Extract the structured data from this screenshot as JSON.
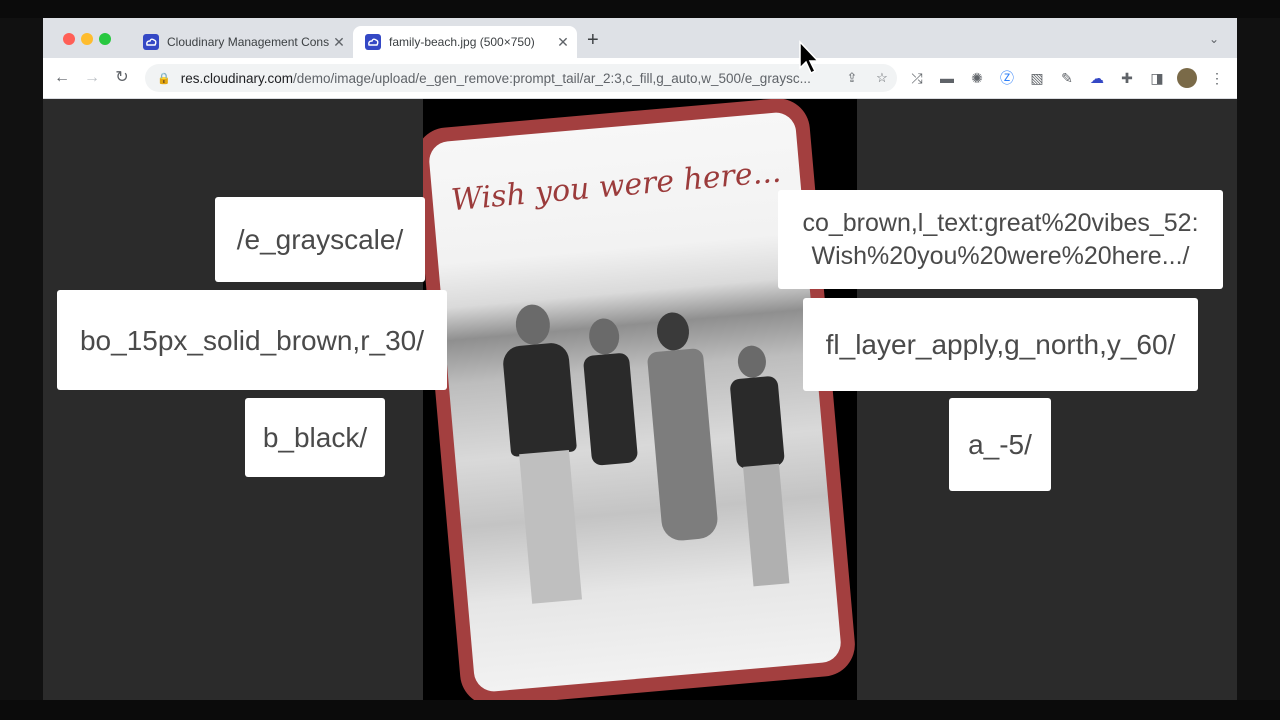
{
  "browser": {
    "tabs": [
      {
        "title": "Cloudinary Management Cons",
        "active": false
      },
      {
        "title": "family-beach.jpg (500×750)",
        "active": true
      }
    ],
    "new_tab_label": "+",
    "tab_menu_icon": "chevron-down-icon"
  },
  "address_bar": {
    "host": "res.cloudinary.com",
    "path": "/demo/image/upload/e_gen_remove:prompt_tail/ar_2:3,c_fill,g_auto,w_500/e_graysc..."
  },
  "image": {
    "caption": "Wish you were here...",
    "colors": {
      "border": "#a33f3f",
      "caption": "#9b3b3b",
      "background": "#000000"
    }
  },
  "overlays": [
    {
      "text": "/e_grayscale/"
    },
    {
      "text": "bo_15px_solid_brown,r_30/"
    },
    {
      "text": "b_black/"
    },
    {
      "text": "co_brown,l_text:great%20vibes_52: Wish%20you%20were%20here.../"
    },
    {
      "text": "fl_layer_apply,g_north,y_60/"
    },
    {
      "text": "a_-5/"
    }
  ]
}
